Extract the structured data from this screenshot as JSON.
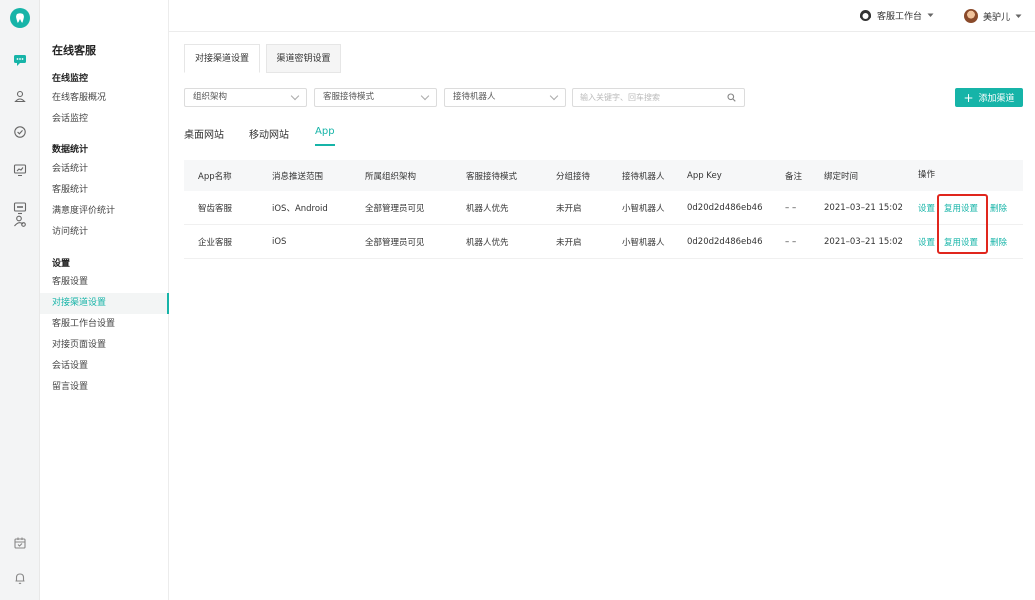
{
  "colors": {
    "accent": "#16b4a8",
    "highlight": "#e0261d"
  },
  "rail": {
    "icons": [
      "tooth-logo-icon",
      "chat-icon",
      "user-pin-icon",
      "clock-check-icon",
      "monitor-chart-icon",
      "screen-chat-icon",
      "users-settings-icon",
      "calendar-icon",
      "bell-icon"
    ]
  },
  "menu": {
    "title": "在线客服",
    "groups": [
      {
        "label": "在线监控",
        "items": [
          "在线客服概况",
          "会话监控"
        ]
      },
      {
        "label": "数据统计",
        "items": [
          "会话统计",
          "客服统计",
          "满意度评价统计",
          "访问统计"
        ]
      },
      {
        "label": "设置",
        "items": [
          "客服设置",
          "对接渠道设置",
          "客服工作台设置",
          "对接页面设置",
          "会话设置",
          "留言设置"
        ]
      }
    ]
  },
  "header": {
    "workspace_label": "客服工作台",
    "user_name": "美驴儿"
  },
  "top_tabs": [
    "对接渠道设置",
    "渠道密钥设置"
  ],
  "filters": {
    "org": "组织架构",
    "mode": "客服接待模式",
    "robot": "接待机器人",
    "search_placeholder": "输入关键字、回车搜索"
  },
  "add_button": "添加渠道",
  "sub_tabs": [
    "桌面网站",
    "移动网站",
    "App"
  ],
  "table": {
    "columns": [
      "App名称",
      "消息推送范围",
      "所属组织架构",
      "客服接待模式",
      "分组接待",
      "接待机器人",
      "App Key",
      "备注",
      "绑定时间",
      "操作"
    ],
    "rows": [
      {
        "name": "智齿客服",
        "push": "iOS、Android",
        "org": "全部管理员可见",
        "mode": "机器人优先",
        "group": "未开启",
        "robot": "小智机器人",
        "key": "0d20d2d486eb46",
        "note": "– –",
        "time": "2021–03–21 15:02"
      },
      {
        "name": "企业客服",
        "push": "iOS",
        "org": "全部管理员可见",
        "mode": "机器人优先",
        "group": "未开启",
        "robot": "小智机器人",
        "key": "0d20d2d486eb46",
        "note": "– –",
        "time": "2021–03–21 15:02"
      }
    ],
    "actions": {
      "settings": "设置",
      "copy": "复用设置",
      "delete": "删除"
    }
  }
}
